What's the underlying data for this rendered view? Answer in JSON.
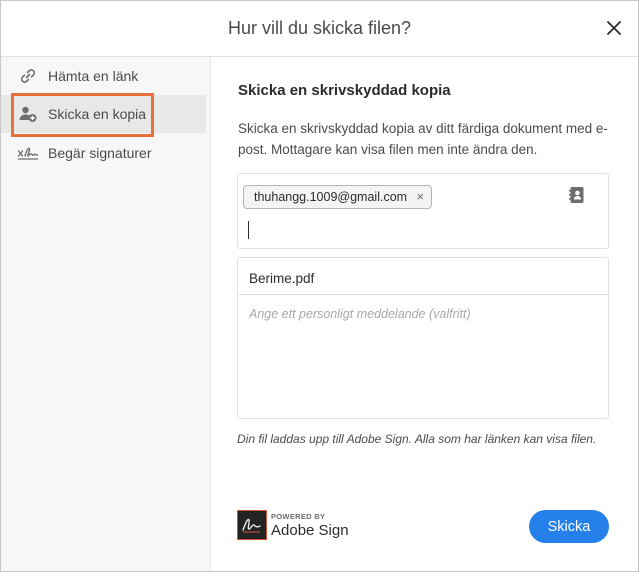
{
  "dialog": {
    "title": "Hur vill du skicka filen?"
  },
  "sidebar": {
    "items": [
      {
        "label": "Hämta en länk",
        "icon": "link-icon",
        "active": false
      },
      {
        "label": "Skicka en kopia",
        "icon": "add-person-icon",
        "active": true
      },
      {
        "label": "Begär signaturer",
        "icon": "signature-icon",
        "active": false
      }
    ]
  },
  "main": {
    "title": "Skicka en skrivskyddad kopia",
    "description": "Skicka en skrivskyddad kopia av ditt färdiga dokument med e-post. Mottagare kan visa filen men inte ändra den.",
    "recipients": [
      {
        "email": "thuhangg.1009@gmail.com",
        "remove": "×"
      }
    ],
    "recipient_input_value": "",
    "file_name": "Berime.pdf",
    "message_placeholder": "Ange ett personligt meddelande (valfritt)",
    "note": "Din fil laddas upp till Adobe Sign. Alla som har länken kan visa filen.",
    "brand": {
      "powered_by": "POWERED BY",
      "name": "Adobe Sign"
    },
    "send_label": "Skicka"
  },
  "colors": {
    "accent": "#2680eb",
    "highlight_outline": "#e8703a",
    "sidebar_background": "#f7f7f7",
    "active_item_background": "#e8e8e8"
  }
}
